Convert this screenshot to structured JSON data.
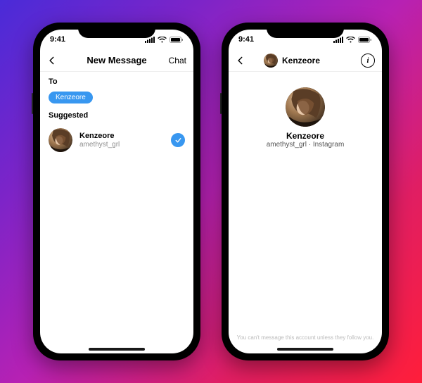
{
  "status": {
    "time": "9:41"
  },
  "left": {
    "nav": {
      "title": "New Message",
      "action": "Chat"
    },
    "to_label": "To",
    "recipient_pill": "Kenzeore",
    "suggested_header": "Suggested",
    "suggested": [
      {
        "name": "Kenzeore",
        "username": "amethyst_grl",
        "selected": true
      }
    ]
  },
  "right": {
    "nav": {
      "title": "Kenzeore"
    },
    "profile": {
      "name": "Kenzeore",
      "subtitle": "amethyst_grl · Instagram"
    },
    "footer": "You can't message this account unless they follow you."
  },
  "icons": {
    "back": "chevron-left-icon",
    "info": "info-icon",
    "check": "check-icon"
  },
  "colors": {
    "accent": "#3897f0"
  }
}
